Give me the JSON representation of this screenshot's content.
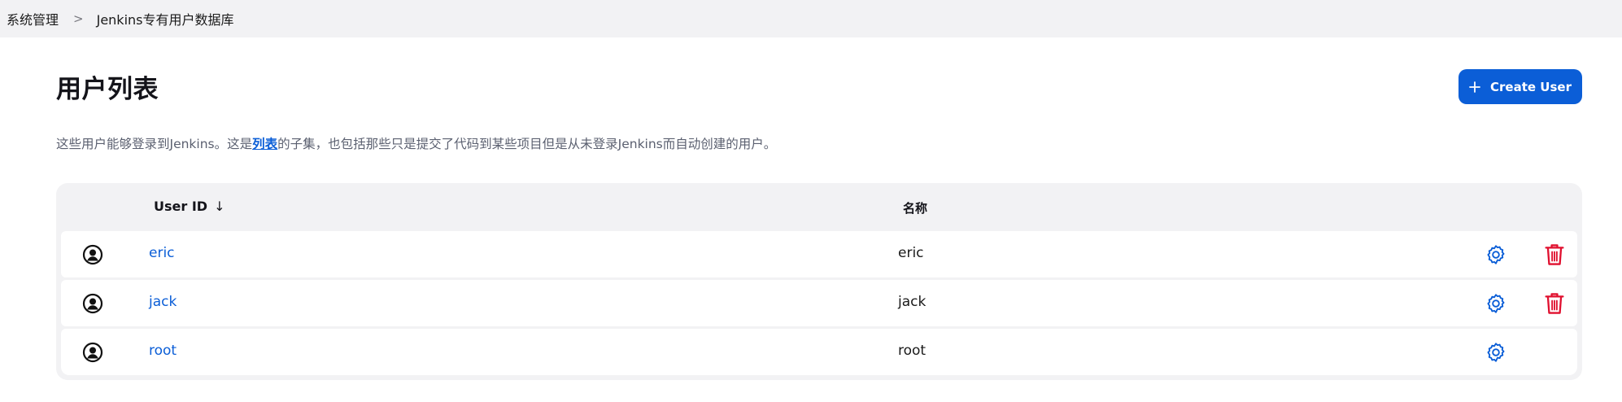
{
  "breadcrumb": {
    "items": [
      {
        "label": "系统管理"
      },
      {
        "label": "Jenkins专有用户数据库"
      }
    ],
    "separator": ">"
  },
  "page": {
    "title": "用户列表",
    "create_button_label": "Create User",
    "description_before": "这些用户能够登录到Jenkins。这是",
    "description_link": "列表",
    "description_after": "的子集，也包括那些只是提交了代码到某些项目但是从未登录Jenkins而自动创建的用户。"
  },
  "table": {
    "columns": {
      "user_id": "User ID",
      "sort_indicator": "↓",
      "name": "名称"
    },
    "rows": [
      {
        "user_id": "eric",
        "name": "eric",
        "can_delete": true
      },
      {
        "user_id": "jack",
        "name": "jack",
        "can_delete": true
      },
      {
        "user_id": "root",
        "name": "root",
        "can_delete": false
      }
    ]
  },
  "icons": {
    "avatar": "user-avatar-icon",
    "configure": "gear-icon",
    "delete": "trash-icon",
    "create": "plus-icon"
  },
  "colors": {
    "accent": "#0b5ed7",
    "danger": "#e0102f",
    "header_bg": "#f2f2f4",
    "table_bg": "#f2f2f4"
  }
}
